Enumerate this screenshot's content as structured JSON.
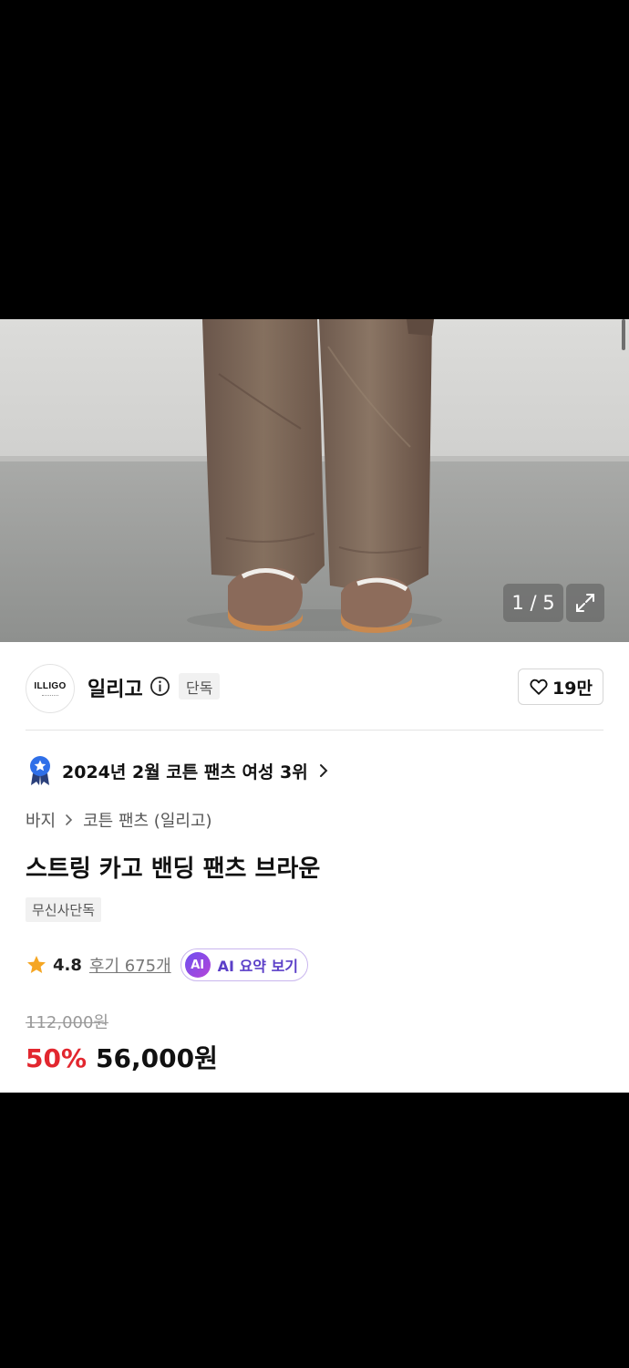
{
  "gallery": {
    "counter": "1 / 5",
    "expand_icon": "expand-icon",
    "background_color": "#d6d6d4",
    "pants_color": "#7a6559"
  },
  "brand": {
    "logo_text": "ILLIGO",
    "name": "일리고",
    "info_icon": "info-icon",
    "tag": "단독",
    "likes": "19만",
    "like_icon": "heart-outline-icon"
  },
  "ranking": {
    "icon": "ranking-badge-icon",
    "text": "2024년 2월 코튼 팬츠 여성 3위"
  },
  "breadcrumb": {
    "category": "바지",
    "subcategory": "코튼 팬츠 (일리고)"
  },
  "product": {
    "title": "스트링 카고 밴딩 팬츠 브라운",
    "tag": "무신사단독"
  },
  "rating": {
    "score": "4.8",
    "reviews": "후기 675개",
    "ai_badge": "AI",
    "ai_label": "AI 요약 보기"
  },
  "price": {
    "original": "112,000원",
    "discount": "50%",
    "sale": "56,000원",
    "discount_color": "#e2272f"
  }
}
